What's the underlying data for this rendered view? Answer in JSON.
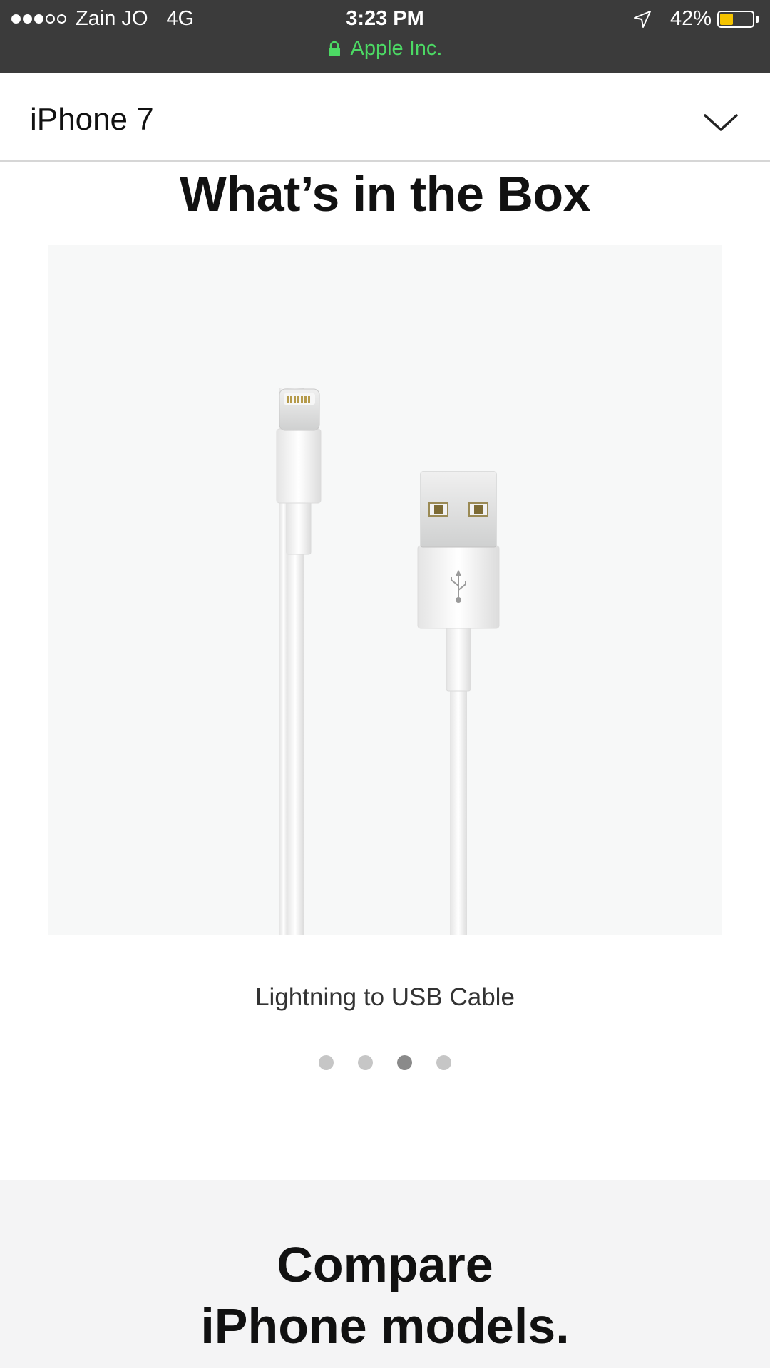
{
  "status_bar": {
    "signal": {
      "filled": 3,
      "empty": 2
    },
    "carrier": "Zain JO",
    "network": "4G",
    "time": "3:23 PM",
    "battery_text": "42%",
    "battery_level": 0.42,
    "battery_color": "#f5c400",
    "url_label": "Apple Inc.",
    "url_color": "#4cd964",
    "icons": [
      "location-arrow-icon",
      "battery-icon",
      "lock-icon"
    ]
  },
  "nav": {
    "title": "iPhone 7",
    "icon": "chevron-down-icon"
  },
  "section": {
    "title": "What’s in the Box",
    "caption": "Lightning to USB Cable",
    "pagination": {
      "count": 4,
      "active_index": 2
    }
  },
  "compare": {
    "title_line1": "Compare",
    "title_line2": "iPhone models."
  }
}
